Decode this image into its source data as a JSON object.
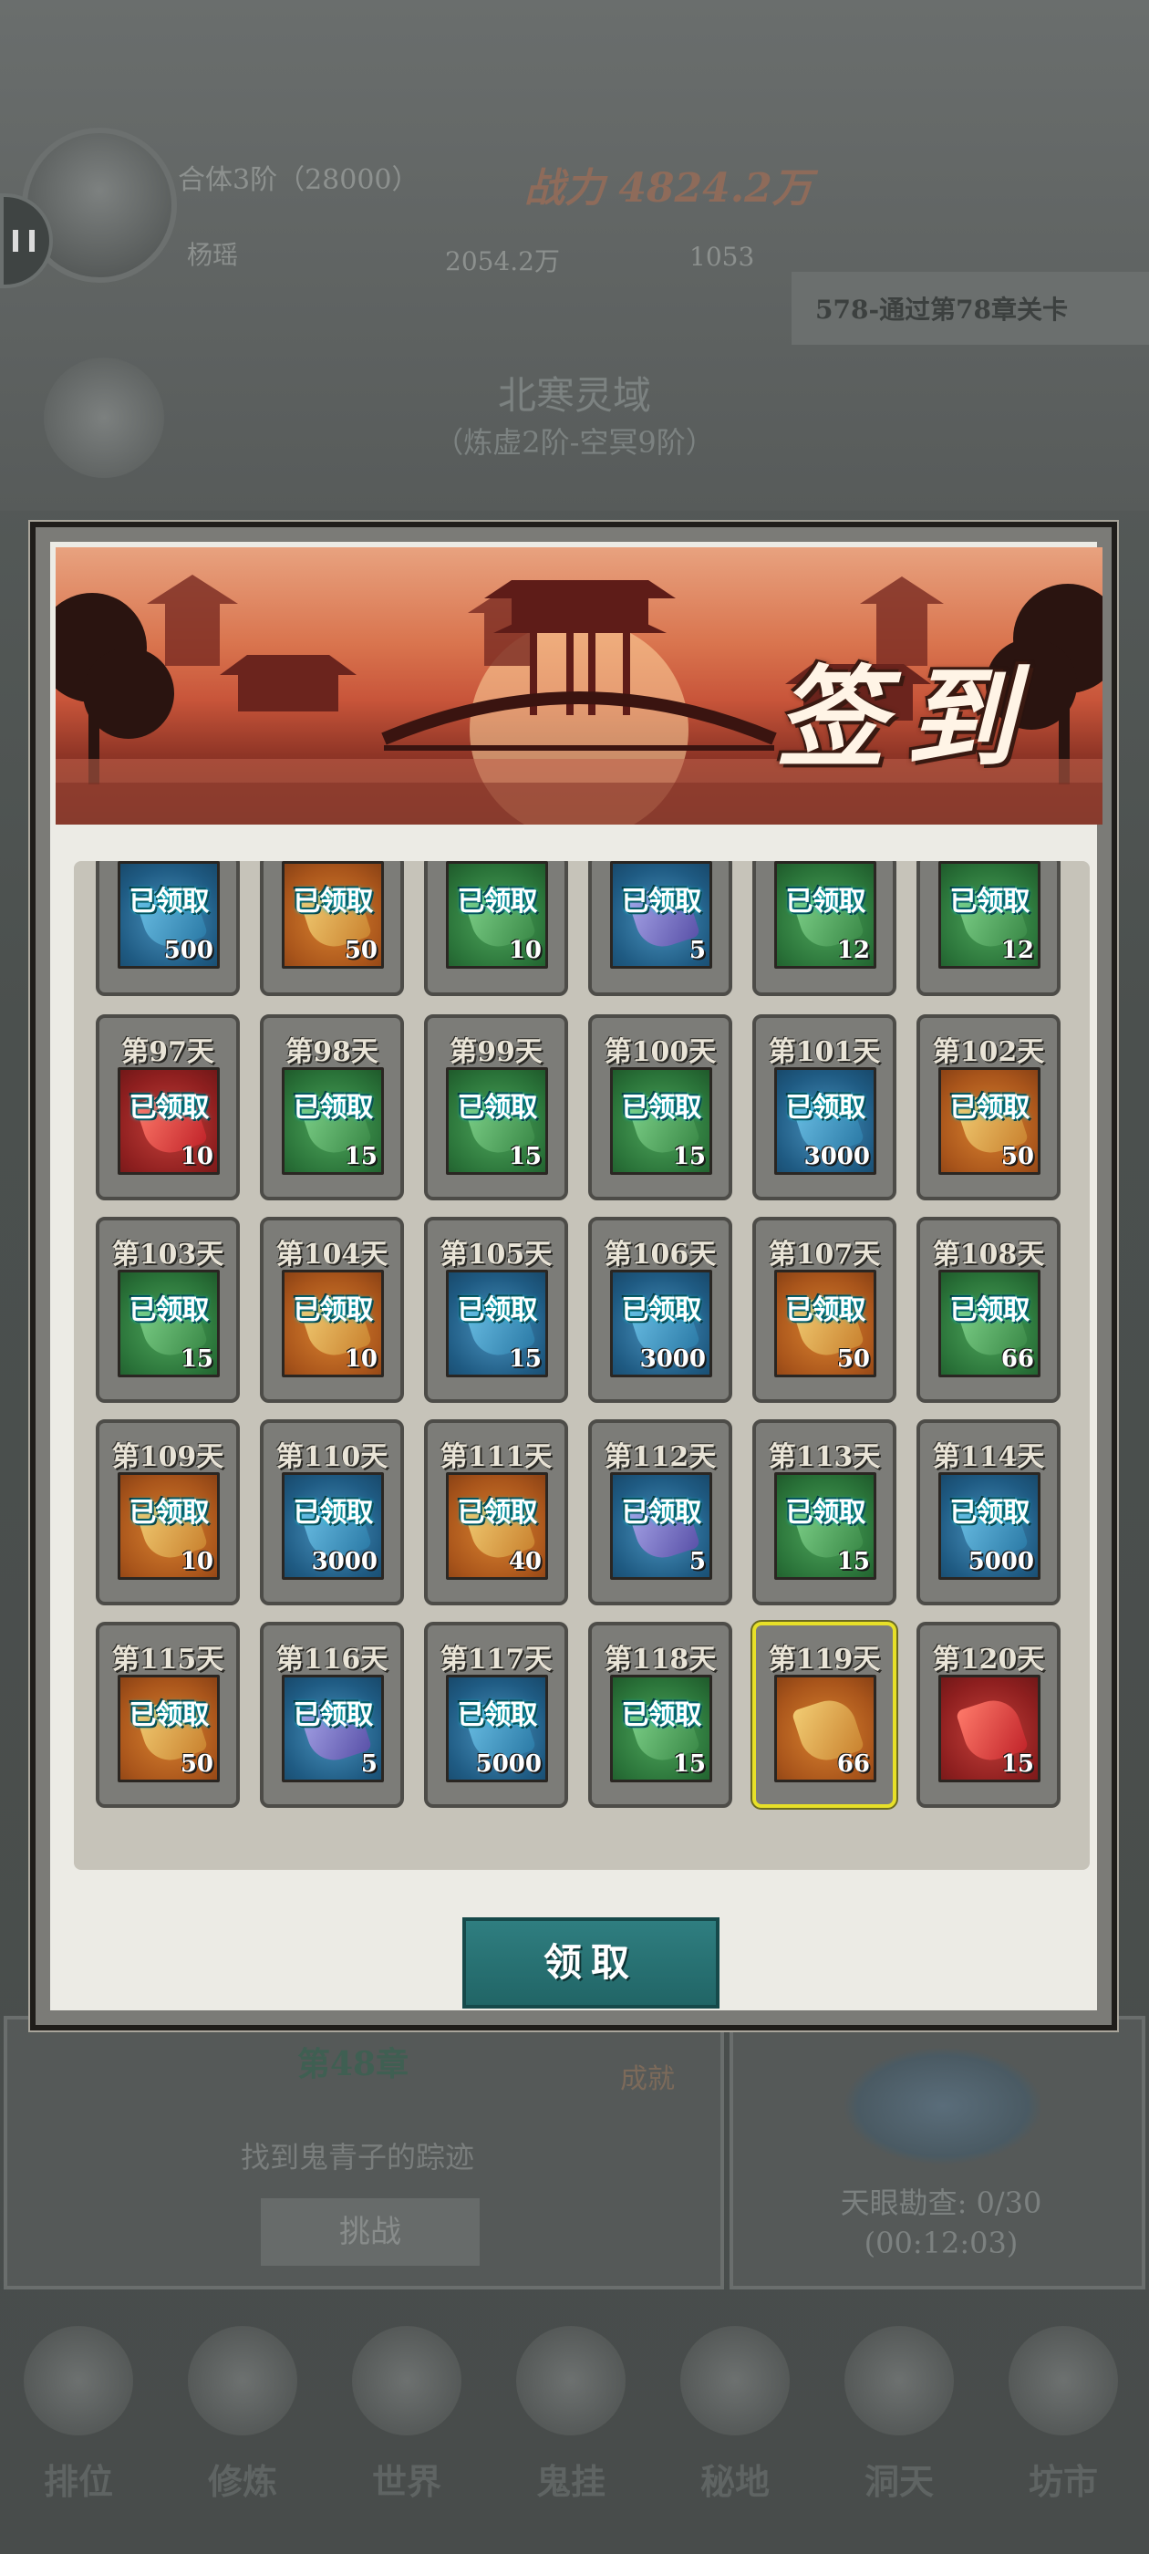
{
  "background": {
    "realm": "合体3阶（28000）",
    "power": "战力 4824.2万",
    "name": "杨瑶",
    "resource1": "2054.2万",
    "resource2": "1053",
    "stage_tip": "578-通过第78章关卡",
    "region_name": "北寒灵域",
    "region_range": "（炼虚2阶-空冥9阶）",
    "chapter": "第48章",
    "chapter_goal": "找到鬼青子的踪迹",
    "challenge_label": "挑战",
    "achievement_label": "成就",
    "eye_progress": "天眼勘查: 0/30",
    "eye_timer": "(00:12:03)",
    "nav": [
      "排位",
      "修炼",
      "世界",
      "鬼挂",
      "秘地",
      "洞天",
      "坊市"
    ]
  },
  "modal": {
    "title": "签到",
    "claim_button": "领取",
    "claimed_label": "已领取",
    "rows": [
      [
        {
          "day": "",
          "color": "blue",
          "qty": "500",
          "claimed": true
        },
        {
          "day": "",
          "color": "orange",
          "qty": "50",
          "claimed": true
        },
        {
          "day": "",
          "color": "green",
          "qty": "10",
          "claimed": true
        },
        {
          "day": "",
          "color": "blue",
          "item": "purple",
          "qty": "5",
          "claimed": true
        },
        {
          "day": "",
          "color": "green",
          "qty": "12",
          "claimed": true
        },
        {
          "day": "",
          "color": "green",
          "qty": "12",
          "claimed": true
        }
      ],
      [
        {
          "day": "第97天",
          "color": "red",
          "qty": "10",
          "claimed": true
        },
        {
          "day": "第98天",
          "color": "green",
          "qty": "15",
          "claimed": true
        },
        {
          "day": "第99天",
          "color": "green",
          "qty": "15",
          "claimed": true
        },
        {
          "day": "第100天",
          "color": "green",
          "qty": "15",
          "claimed": true
        },
        {
          "day": "第101天",
          "color": "blue",
          "qty": "3000",
          "claimed": true
        },
        {
          "day": "第102天",
          "color": "orange",
          "qty": "50",
          "claimed": true
        }
      ],
      [
        {
          "day": "第103天",
          "color": "green",
          "qty": "15",
          "claimed": true
        },
        {
          "day": "第104天",
          "color": "orange",
          "qty": "10",
          "claimed": true
        },
        {
          "day": "第105天",
          "color": "blue",
          "qty": "15",
          "claimed": true
        },
        {
          "day": "第106天",
          "color": "blue",
          "qty": "3000",
          "claimed": true
        },
        {
          "day": "第107天",
          "color": "orange",
          "qty": "50",
          "claimed": true
        },
        {
          "day": "第108天",
          "color": "green",
          "qty": "66",
          "claimed": true
        }
      ],
      [
        {
          "day": "第109天",
          "color": "orange",
          "qty": "10",
          "claimed": true
        },
        {
          "day": "第110天",
          "color": "blue",
          "qty": "3000",
          "claimed": true
        },
        {
          "day": "第111天",
          "color": "orange",
          "qty": "40",
          "claimed": true
        },
        {
          "day": "第112天",
          "color": "blue",
          "item": "purple",
          "qty": "5",
          "claimed": true
        },
        {
          "day": "第113天",
          "color": "green",
          "qty": "15",
          "claimed": true
        },
        {
          "day": "第114天",
          "color": "blue",
          "qty": "5000",
          "claimed": true
        }
      ],
      [
        {
          "day": "第115天",
          "color": "orange",
          "qty": "50",
          "claimed": true
        },
        {
          "day": "第116天",
          "color": "blue",
          "item": "purple",
          "qty": "5",
          "claimed": true
        },
        {
          "day": "第117天",
          "color": "blue",
          "qty": "5000",
          "claimed": true
        },
        {
          "day": "第118天",
          "color": "green",
          "qty": "15",
          "claimed": true
        },
        {
          "day": "第119天",
          "color": "orange",
          "qty": "66",
          "claimed": false,
          "selected": true
        },
        {
          "day": "第120天",
          "color": "red",
          "qty": "15",
          "claimed": false
        }
      ]
    ]
  }
}
